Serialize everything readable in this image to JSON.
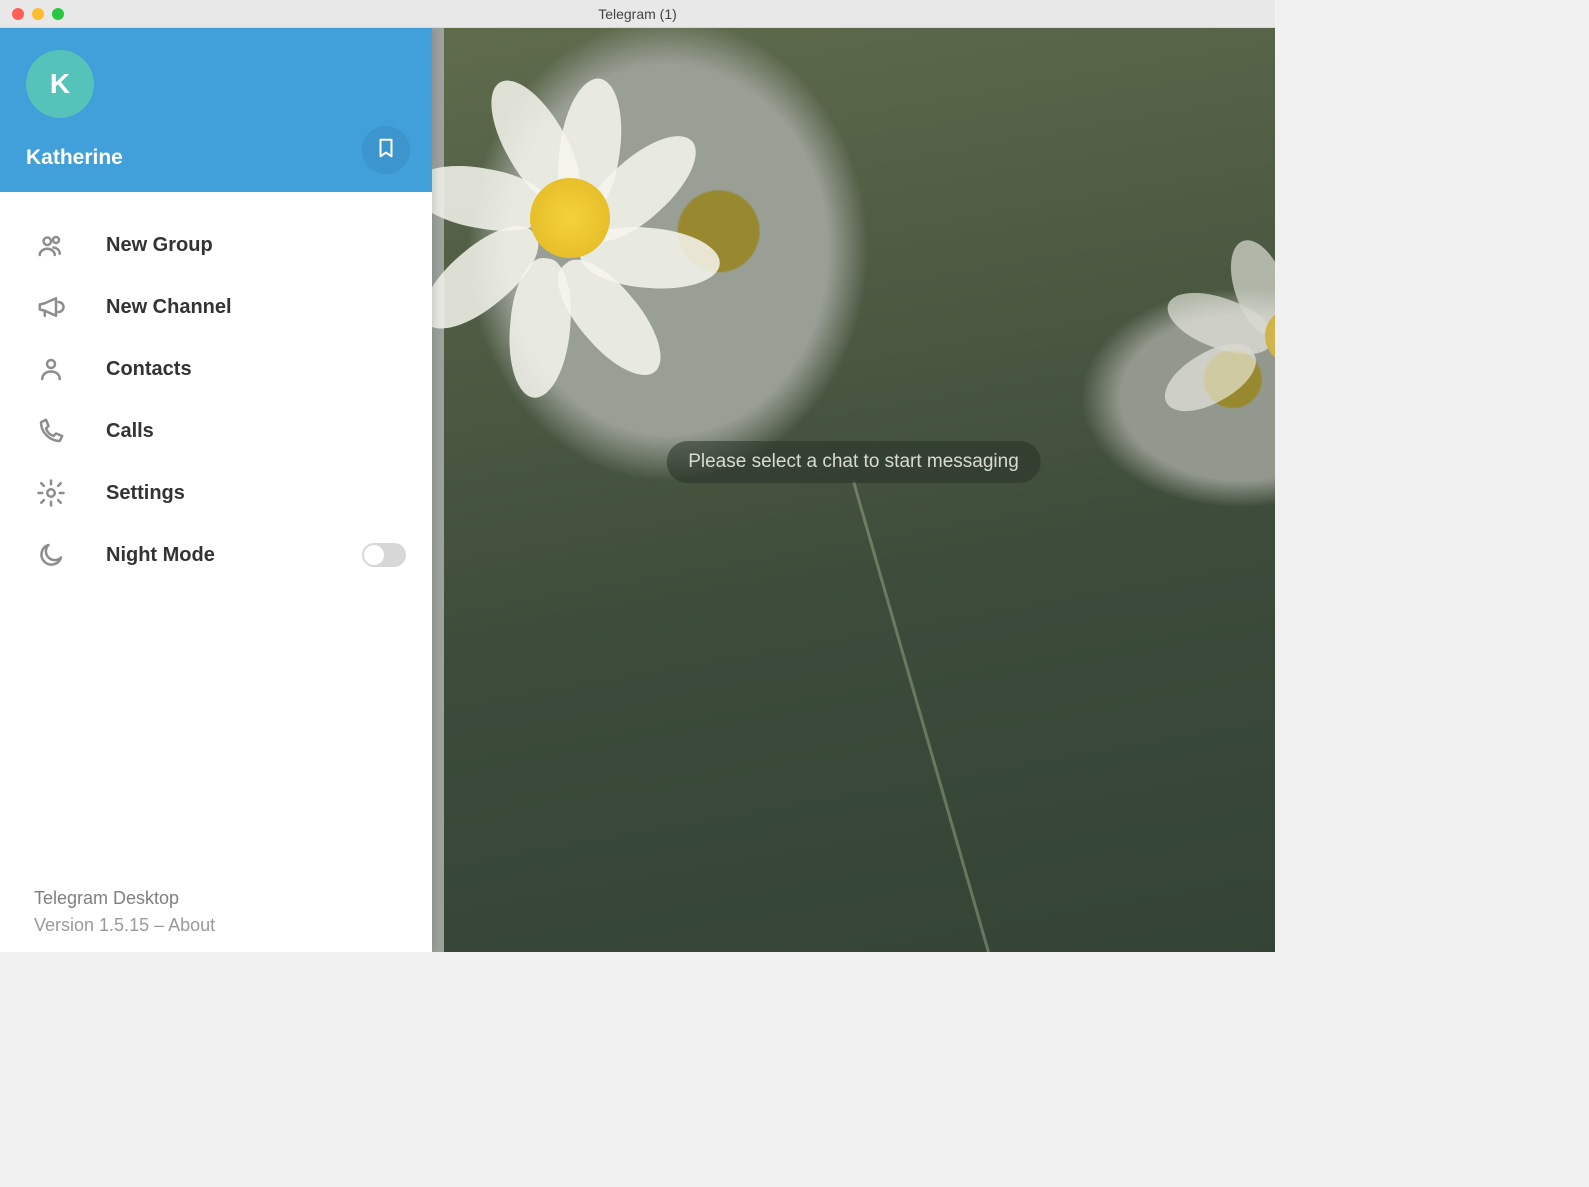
{
  "titlebar": {
    "title": "Telegram (1)"
  },
  "drawer": {
    "avatar_initial": "K",
    "username": "Katherine"
  },
  "menu": {
    "items": [
      {
        "label": "New Group",
        "icon": "group-icon"
      },
      {
        "label": "New Channel",
        "icon": "megaphone-icon"
      },
      {
        "label": "Contacts",
        "icon": "person-icon"
      },
      {
        "label": "Calls",
        "icon": "phone-icon"
      },
      {
        "label": "Settings",
        "icon": "gear-icon"
      },
      {
        "label": "Night Mode",
        "icon": "moon-icon",
        "toggle": false
      }
    ]
  },
  "footer": {
    "app_name": "Telegram Desktop",
    "version_prefix": "Version 1.5.15 – ",
    "about_label": "About"
  },
  "main": {
    "placeholder": "Please select a chat to start messaging"
  },
  "colors": {
    "accent": "#419fd9",
    "avatar_bg": "#56c3bb"
  }
}
